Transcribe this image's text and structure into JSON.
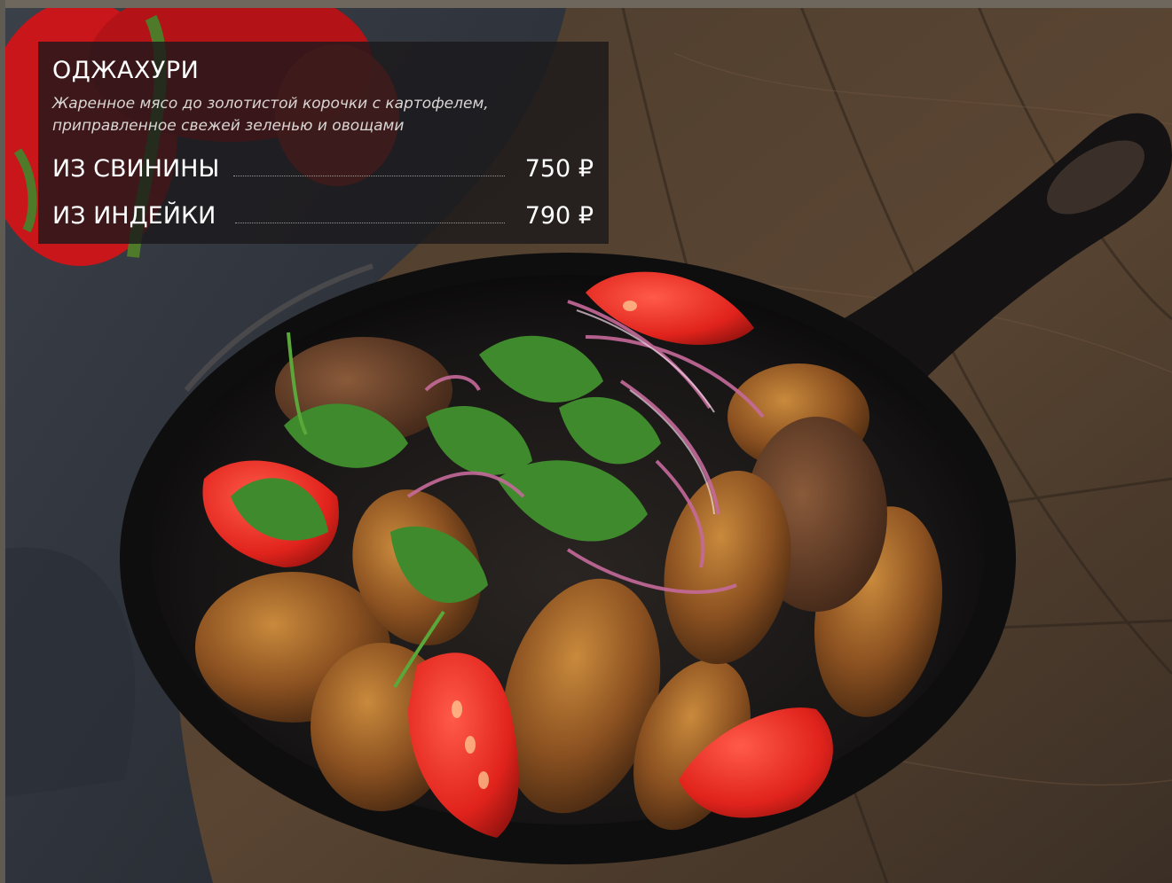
{
  "dish": {
    "title": "ОДЖАХУРИ",
    "description": [
      "Жаренное мясо до золотистой корочки с картофелем,",
      "приправленное свежей зеленью и овощами"
    ],
    "options": [
      {
        "name": "ИЗ СВИНИНЫ",
        "price": "750 ₽"
      },
      {
        "name": "ИЗ ИНДЕЙКИ",
        "price": "790 ₽"
      }
    ]
  },
  "colors": {
    "card_background": "#1a181a",
    "text": "#ffffff",
    "description_text": "#d9d6d3"
  }
}
